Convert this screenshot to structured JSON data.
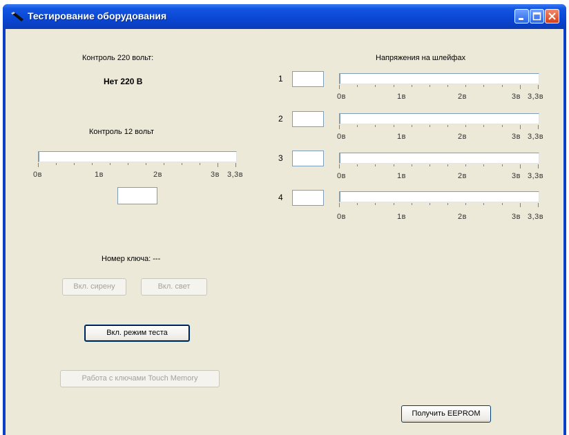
{
  "window": {
    "title": "Тестирование оборудования"
  },
  "left": {
    "control220_label": "Контроль 220 вольт:",
    "control220_status": "Нет 220 В",
    "control12_label": "Контроль 12 вольт",
    "control12_value": "",
    "key_label": "Номер ключа: ---",
    "siren_button": "Вкл. сирену",
    "light_button": "Вкл. свет",
    "test_mode_button": "Вкл. режим теста",
    "touch_memory_button": "Работа с ключами Touch Memory"
  },
  "scale_labels": [
    "0в",
    "1в",
    "2в",
    "3в",
    "3,3в"
  ],
  "right": {
    "title": "Напряжения на шлейфах",
    "loops": [
      {
        "number": "1",
        "value": ""
      },
      {
        "number": "2",
        "value": ""
      },
      {
        "number": "3",
        "value": ""
      },
      {
        "number": "4",
        "value": ""
      }
    ],
    "eeprom_button": "Получить EEPROM"
  }
}
